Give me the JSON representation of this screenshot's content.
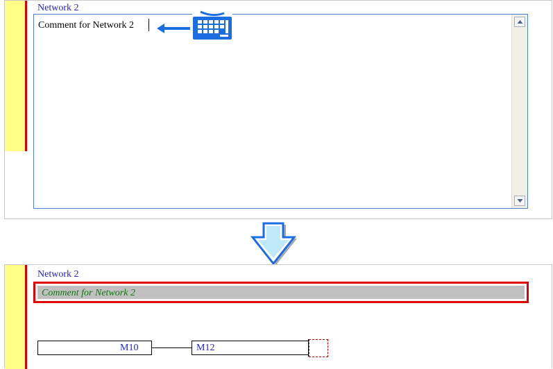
{
  "before": {
    "network_label": "Network 2",
    "comment_text": "Comment for Network 2",
    "scroll_up_icon": "scroll-up-arrow",
    "scroll_down_icon": "scroll-down-arrow",
    "input_icon": "keyboard-icon"
  },
  "transition_icon": "down-arrow",
  "after": {
    "network_label": "Network 2",
    "comment_text": "Comment for Network 2",
    "contacts": [
      {
        "label": "M10"
      },
      {
        "label": "M12"
      }
    ]
  },
  "colors": {
    "network_label": "#1f1fc8",
    "comment_text": "#107810",
    "highlight_border": "#e00000",
    "power_rail": "#d80000",
    "gutter": "#ffff88"
  }
}
